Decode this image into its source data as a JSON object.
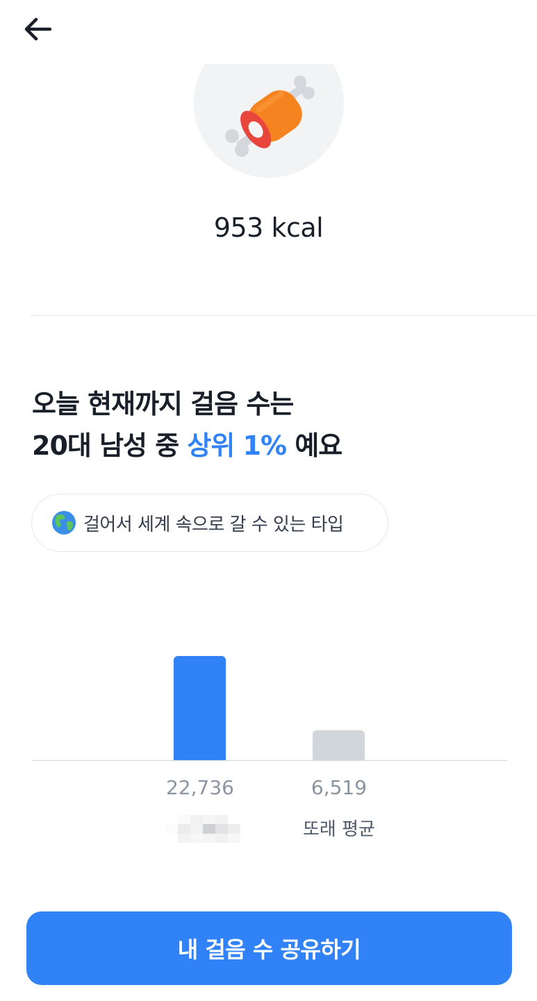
{
  "header": {
    "back_icon": "arrow-left-icon"
  },
  "hero": {
    "icon": "meat-on-bone-icon",
    "kcal_value": "953",
    "kcal_unit": "kcal"
  },
  "headline": {
    "line1": "오늘 현재까지 걸음 수는",
    "line2_prefix": "20대 남성 중 ",
    "line2_highlight": "상위 1%",
    "line2_suffix": " 예요",
    "highlight_color": "#3182f6"
  },
  "type_chip": {
    "icon": "globe-icon",
    "label": "걸어서 세계 속으로 갈 수 있는 타입"
  },
  "chart_data": {
    "type": "bar",
    "categories": [
      "",
      "또래 평균"
    ],
    "values": [
      22736,
      6519
    ],
    "value_labels": [
      "22,736",
      "6,519"
    ],
    "ylim": [
      0,
      22736
    ],
    "colors": [
      "#3182f6",
      "#d1d6db"
    ]
  },
  "share_button": {
    "label": "내 걸음 수 공유하기"
  }
}
